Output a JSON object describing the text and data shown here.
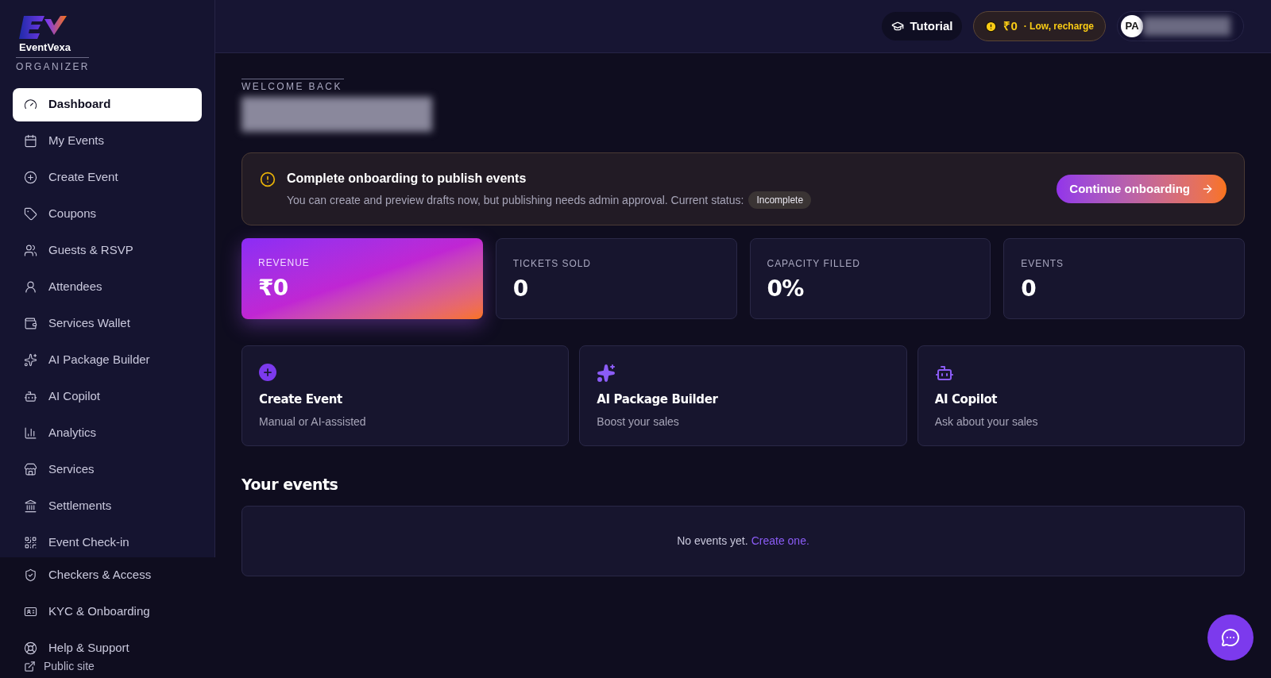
{
  "brand": {
    "name": "EventVexa",
    "role": "ORGANIZER"
  },
  "sidebar": {
    "items": [
      {
        "label": "Dashboard",
        "selected": true
      },
      {
        "label": "My Events",
        "selected": false
      },
      {
        "label": "Create Event",
        "selected": false
      },
      {
        "label": "Coupons",
        "selected": false
      },
      {
        "label": "Guests & RSVP",
        "selected": false
      },
      {
        "label": "Attendees",
        "selected": false
      },
      {
        "label": "Services Wallet",
        "selected": false
      },
      {
        "label": "AI Package Builder",
        "selected": false
      },
      {
        "label": "AI Copilot",
        "selected": false
      },
      {
        "label": "Analytics",
        "selected": false
      },
      {
        "label": "Services",
        "selected": false
      },
      {
        "label": "Settlements",
        "selected": false
      },
      {
        "label": "Event Check-in",
        "selected": false
      },
      {
        "label": "Checkers & Access",
        "selected": false
      },
      {
        "label": "KYC & Onboarding",
        "selected": false
      },
      {
        "label": "Help & Support",
        "selected": false
      }
    ],
    "footer_link": "Public site"
  },
  "header": {
    "tutorial": "Tutorial",
    "wallet": {
      "amount": "₹0",
      "note": "· Low, recharge"
    },
    "user": {
      "initials": "PA"
    }
  },
  "welcome": {
    "eyebrow": "WELCOME BACK"
  },
  "banner": {
    "title": "Complete onboarding to publish events",
    "text": "You can create and preview drafts now, but publishing needs admin approval. Current status:",
    "status": "Incomplete",
    "button": "Continue onboarding"
  },
  "stats": [
    {
      "label": "REVENUE",
      "value": "₹0",
      "selected": true
    },
    {
      "label": "TICKETS SOLD",
      "value": "0",
      "selected": false
    },
    {
      "label": "CAPACITY FILLED",
      "value": "0%",
      "selected": false
    },
    {
      "label": "EVENTS",
      "value": "0",
      "selected": false
    }
  ],
  "actions": [
    {
      "title": "Create Event",
      "subtitle": "Manual or AI-assisted"
    },
    {
      "title": "AI Package Builder",
      "subtitle": "Boost your sales"
    },
    {
      "title": "AI Copilot",
      "subtitle": "Ask about your sales"
    }
  ],
  "events": {
    "heading": "Your events",
    "empty_text": "No events yet.",
    "link": "Create one."
  }
}
